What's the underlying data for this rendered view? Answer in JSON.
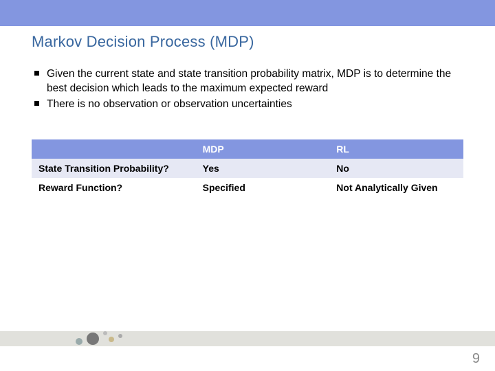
{
  "colors": {
    "accent": "#8396e0",
    "title": "#39679f",
    "footer_band": "#e1e1dc",
    "page_number": "#8a8a8a"
  },
  "header": {
    "title": "Markov Decision Process (MDP)"
  },
  "bullets": [
    "Given the current state and state transition probability matrix, MDP is to determine the best decision which leads to the maximum expected reward",
    "There is no observation or observation uncertainties"
  ],
  "table": {
    "columns": [
      "",
      "MDP",
      "RL"
    ],
    "rows": [
      {
        "label": "State Transition Probability?",
        "mdp": "Yes",
        "rl": "No"
      },
      {
        "label": "Reward Function?",
        "mdp": "Specified",
        "rl": "Not Analytically Given"
      }
    ]
  },
  "page_number": "9"
}
